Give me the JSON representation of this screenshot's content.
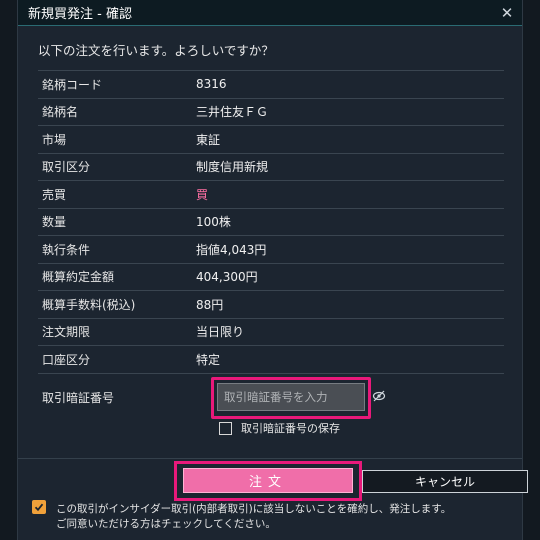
{
  "dialog": {
    "title": "新規買発注 - 確認",
    "close_glyph": "✕",
    "question": "以下の注文を行います。よろしいですか？"
  },
  "details": [
    {
      "label": "銘柄コード",
      "value": "8316"
    },
    {
      "label": "銘柄名",
      "value": "三井住友ＦＧ"
    },
    {
      "label": "市場",
      "value": "東証"
    },
    {
      "label": "取引区分",
      "value": "制度信用新規"
    },
    {
      "label": "売買",
      "value": "買"
    },
    {
      "label": "数量",
      "value": "100株"
    },
    {
      "label": "執行条件",
      "value": "指値4,043円"
    },
    {
      "label": "概算約定金額",
      "value": "404,300円"
    },
    {
      "label": "概算手数料(税込)",
      "value": "88円"
    },
    {
      "label": "注文期限",
      "value": "当日限り"
    },
    {
      "label": "口座区分",
      "value": "特定"
    }
  ],
  "password": {
    "label": "取引暗証番号",
    "placeholder": "取引暗証番号を入力",
    "save_label": "取引暗証番号の保存"
  },
  "buttons": {
    "order": "注文",
    "cancel": "キャンセル"
  },
  "insider": {
    "line1": "この取引がインサイダー取引(内部者取引)に該当しないことを確約し、発注します。",
    "line2": "ご同意いただける方はチェックしてください。",
    "checked": true
  },
  "colors": {
    "accent_pink": "#f06ea9",
    "highlight_magenta": "#e8197a",
    "check_orange": "#f0a13a"
  }
}
